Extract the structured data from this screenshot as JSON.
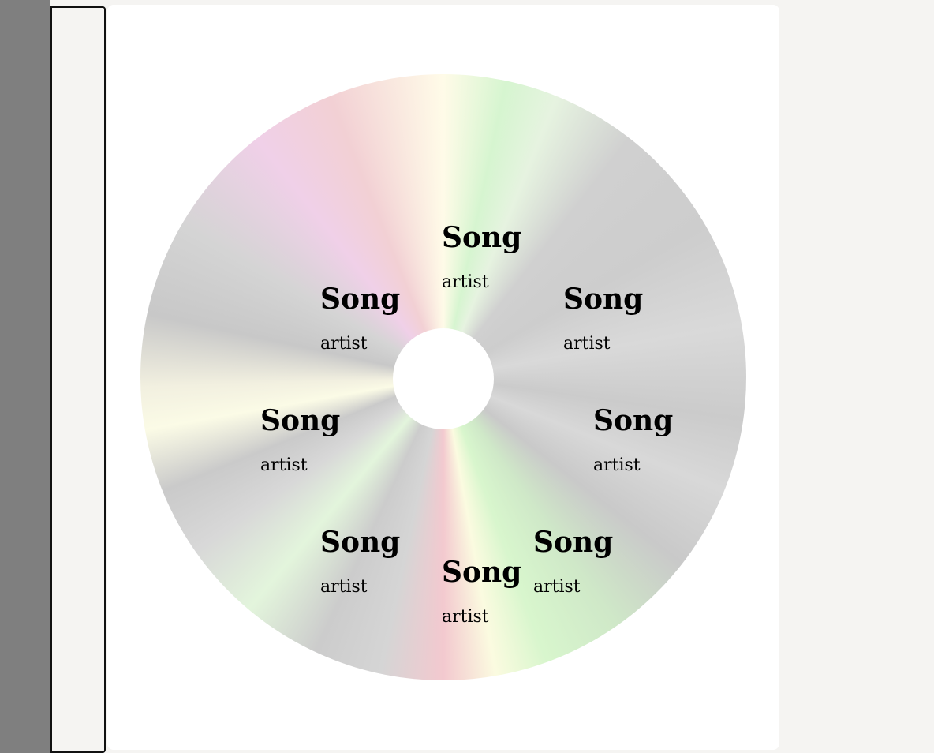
{
  "tracks": [
    {
      "title": "Song",
      "artist": "artist"
    },
    {
      "title": "Song",
      "artist": "artist"
    },
    {
      "title": "Song",
      "artist": "artist"
    },
    {
      "title": "Song",
      "artist": "artist"
    },
    {
      "title": "Song",
      "artist": "artist"
    },
    {
      "title": "Song",
      "artist": "artist"
    },
    {
      "title": "Song",
      "artist": "artist"
    },
    {
      "title": "Song",
      "artist": "artist"
    }
  ]
}
